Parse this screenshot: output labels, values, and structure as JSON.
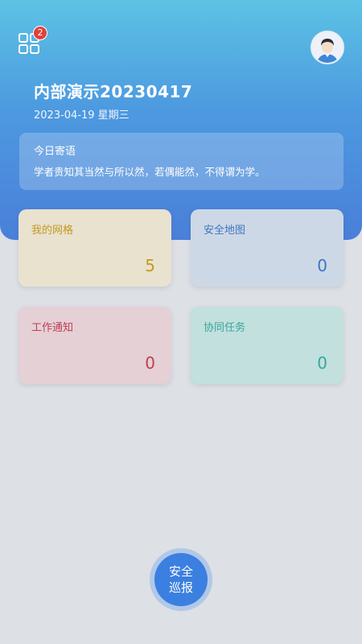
{
  "header": {
    "title": "内部演示20230417",
    "date_line": "2023-04-19 星期三",
    "badge_count": "2",
    "apps_icon": "grid-apps-icon",
    "avatar_icon": "user-avatar-icon"
  },
  "quote": {
    "title": "今日寄语",
    "text": "学者贵知其当然与所以然，若偶能然，不得谓为学。"
  },
  "tiles": [
    {
      "label": "我的网格",
      "count": "5",
      "color": "#c39a1f"
    },
    {
      "label": "安全地图",
      "count": "0",
      "color": "#3e76c0"
    },
    {
      "label": "工作通知",
      "count": "0",
      "color": "#c23d52"
    },
    {
      "label": "协同任务",
      "count": "0",
      "color": "#35a79d"
    }
  ],
  "patrol": {
    "line1": "安全",
    "line2": "巡报"
  },
  "colors": {
    "accent": "#3b7fe0",
    "background": "#dde0e5"
  }
}
